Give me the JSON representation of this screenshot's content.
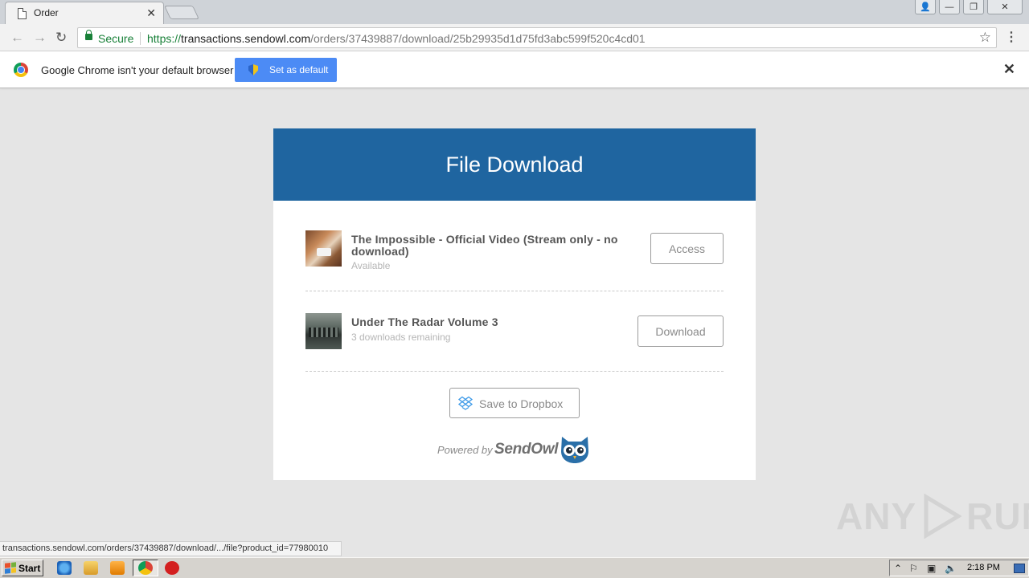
{
  "browser": {
    "tab": {
      "title": "Order",
      "close_glyph": "✕"
    },
    "window_buttons": {
      "user": "👤",
      "minimize": "—",
      "restore": "❐",
      "close": "✕"
    },
    "nav": {
      "back": "←",
      "forward": "→",
      "reload": "↻"
    },
    "omnibox": {
      "secure_label": "Secure",
      "url_scheme": "https://",
      "url_host": "transactions.sendowl.com",
      "url_path": "/orders/37439887/download/25b29935d1d75fd3abc599f520c4cd01"
    },
    "star_glyph": "☆",
    "menu_glyph": "⋮",
    "infobar": {
      "message": "Google Chrome isn't your default browser",
      "button_label": "Set as default",
      "close_glyph": "✕"
    },
    "status_url": "transactions.sendowl.com/orders/37439887/download/.../file?product_id=77980010"
  },
  "page": {
    "header_title": "File Download",
    "items": [
      {
        "title": "The Impossible - Official Video (Stream only - no download)",
        "subtitle": "Available",
        "button_label": "Access"
      },
      {
        "title": "Under The Radar Volume 3",
        "subtitle": "3 downloads remaining",
        "button_label": "Download"
      }
    ],
    "dropbox_button_label": "Save to Dropbox",
    "powered_by": "Powered by",
    "brand": "SendOwl"
  },
  "colors": {
    "header_blue": "#1f65a0",
    "secure_green": "#188038",
    "infobar_button": "#4c8bf5",
    "dropbox_blue": "#3d9ae8",
    "owl_blue": "#2a6fa8"
  },
  "watermark": {
    "left": "ANY",
    "right": "RUN"
  },
  "taskbar": {
    "start_label": "Start",
    "clock": "2:18 PM"
  }
}
